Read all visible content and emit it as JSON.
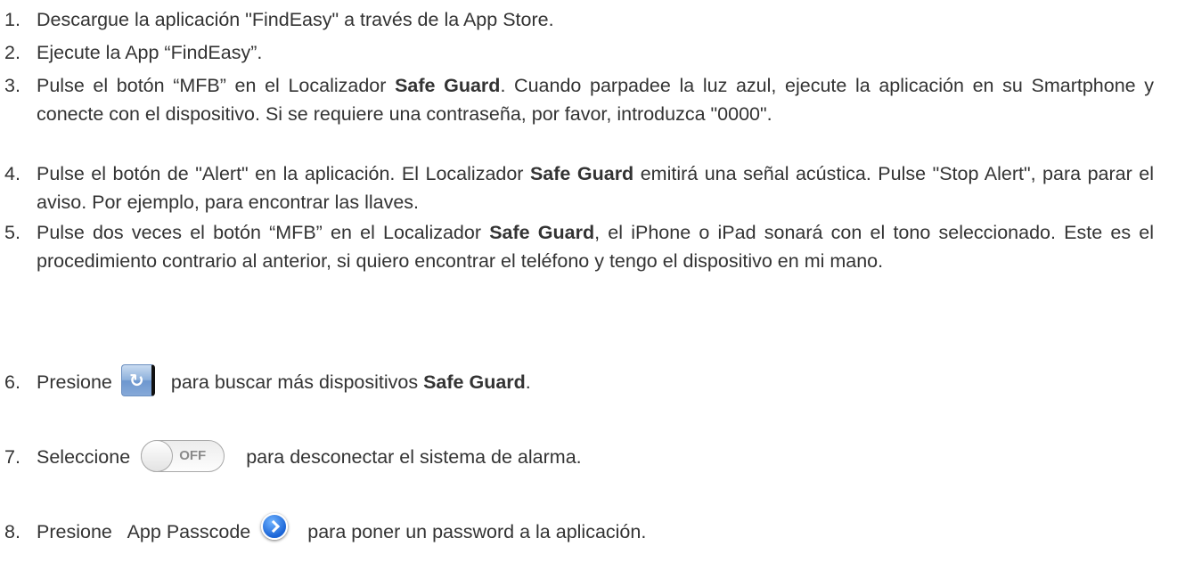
{
  "steps": [
    {
      "number": "1.",
      "text": "Descargue la aplicación \"FindEasy\" a través de la App Store."
    },
    {
      "number": "2.",
      "text": "Ejecute la App “FindEasy”."
    },
    {
      "number": "3.",
      "part1": "Pulse el botón “MFB” en el Localizador ",
      "bold": "Safe Guard",
      "part2": ". Cuando parpadee la luz azul, ejecute la aplicación en su Smartphone y conecte con el dispositivo. Si se requiere una contraseña, por favor, introduzca \"0000\"."
    },
    {
      "number": "4.",
      "part1": "Pulse el botón de \"Alert\" en la aplicación. El Localizador ",
      "bold": "Safe Guard",
      "part2": " emitirá una señal acústica. Pulse \"Stop Alert\", para parar el aviso. Por ejemplo, para encontrar las llaves."
    },
    {
      "number": "5.",
      "part1": "Pulse dos veces el botón “MFB” en el Localizador ",
      "bold": "Safe Guard",
      "part2": ", el iPhone o iPad sonará con el tono seleccionado. Este es el procedimiento contrario al anterior, si quiero encontrar el teléfono y tengo el dispositivo en mi mano."
    },
    {
      "number": "6.",
      "part1": "Presione",
      "icon": "refresh-icon",
      "part2": "para buscar más dispositivos ",
      "bold": "Safe Guard",
      "part3": "."
    },
    {
      "number": "7.",
      "part1": "Seleccione",
      "icon": "toggle-off-icon",
      "toggle_label": "OFF",
      "part2": "para desconectar el sistema de alarma."
    },
    {
      "number": "8.",
      "part1": "Presione   App Passcode",
      "icon": "disclosure-arrow-icon",
      "part2": "para poner un password a la aplicación."
    }
  ],
  "colors": {
    "text": "#333333",
    "refresh_button": "#8eb1dc",
    "disclosure_button": "#1a64d6"
  }
}
